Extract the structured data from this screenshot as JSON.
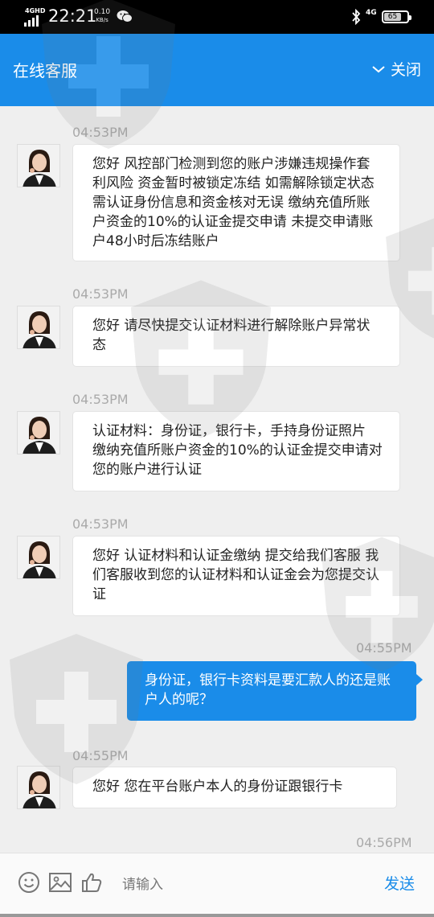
{
  "status_bar": {
    "network": "4GHD",
    "time": "22:21",
    "speed_value": "0.10",
    "speed_unit": "KB/s",
    "right_network": "4G",
    "battery": "65"
  },
  "header": {
    "title": "在线客服",
    "close_label": "关闭",
    "color": "#1a8ce9"
  },
  "messages": [
    {
      "time": "04:53PM",
      "text": "您好 风控部门检测到您的账户涉嫌违规操作套利风险 资金暂时被锁定冻结 如需解除锁定状态需认证身份信息和资金核对无误 缴纳充值所账户资金的10%的认证金提交申请 未提交申请账户48小时后冻结账户"
    },
    {
      "time": "04:53PM",
      "text": "您好 请尽快提交认证材料进行解除账户异常状态"
    },
    {
      "time": "04:53PM",
      "text": "认证材料：身份证，银行卡，手持身份证照片 缴纳充值所账户资金的10%的认证金提交申请对您的账户进行认证"
    },
    {
      "time": "04:53PM",
      "text": "您好 认证材料和认证金缴纳 提交给我们客服 我们客服收到您的认证材料和认证金会为您提交认证"
    },
    {
      "time": "04:55PM",
      "text": "身份证，银行卡资料是要汇款人的还是账户人的呢？"
    },
    {
      "time": "04:55PM",
      "text": "您好 您在平台账户本人的身份证跟银行卡"
    },
    {
      "time": "04:56PM"
    }
  ],
  "input_bar": {
    "placeholder": "请输入",
    "send_label": "发送",
    "icons": [
      "smiley-icon",
      "image-icon",
      "thumbs-up-icon"
    ]
  }
}
